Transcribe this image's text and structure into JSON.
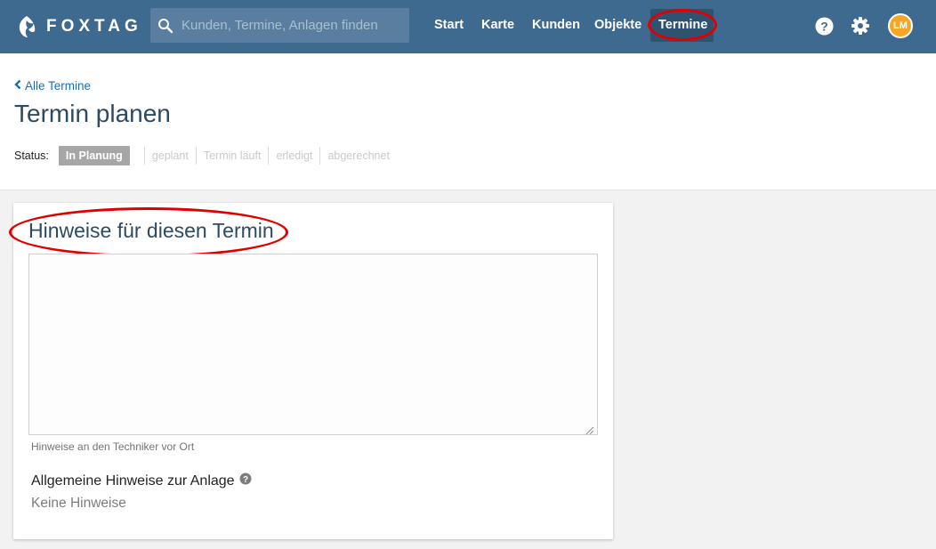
{
  "brand": {
    "name": "FOXTAG"
  },
  "search": {
    "placeholder": "Kunden, Termine, Anlagen finden"
  },
  "nav": {
    "items": [
      {
        "label": "Start"
      },
      {
        "label": "Karte"
      },
      {
        "label": "Kunden"
      },
      {
        "label": "Objekte"
      },
      {
        "label": "Termine",
        "active": true
      }
    ]
  },
  "user": {
    "initials": "LM"
  },
  "breadcrumb": {
    "back_label": "Alle Termine"
  },
  "page": {
    "title": "Termin planen"
  },
  "status": {
    "label": "Status:",
    "steps": [
      {
        "label": "In Planung",
        "active": true
      },
      {
        "label": "geplant"
      },
      {
        "label": "Termin läuft"
      },
      {
        "label": "erledigt"
      },
      {
        "label": "abgerechnet"
      }
    ]
  },
  "notes_card": {
    "title": "Hinweise für diesen Termin",
    "textarea_value": "",
    "help_text": "Hinweise an den Techniker vor Ort",
    "general_label": "Allgemeine Hinweise zur Anlage",
    "general_value": "Keine Hinweise"
  },
  "colors": {
    "topbar": "#3f6a90",
    "accent_link": "#1a6fb3",
    "annotation_red": "#e00000",
    "avatar": "#f5a623"
  },
  "icons": [
    "fox-logo-icon",
    "search-icon",
    "help-circle-icon",
    "gear-icon",
    "chevron-left-icon",
    "question-circle-icon",
    "resize-grip-icon"
  ]
}
